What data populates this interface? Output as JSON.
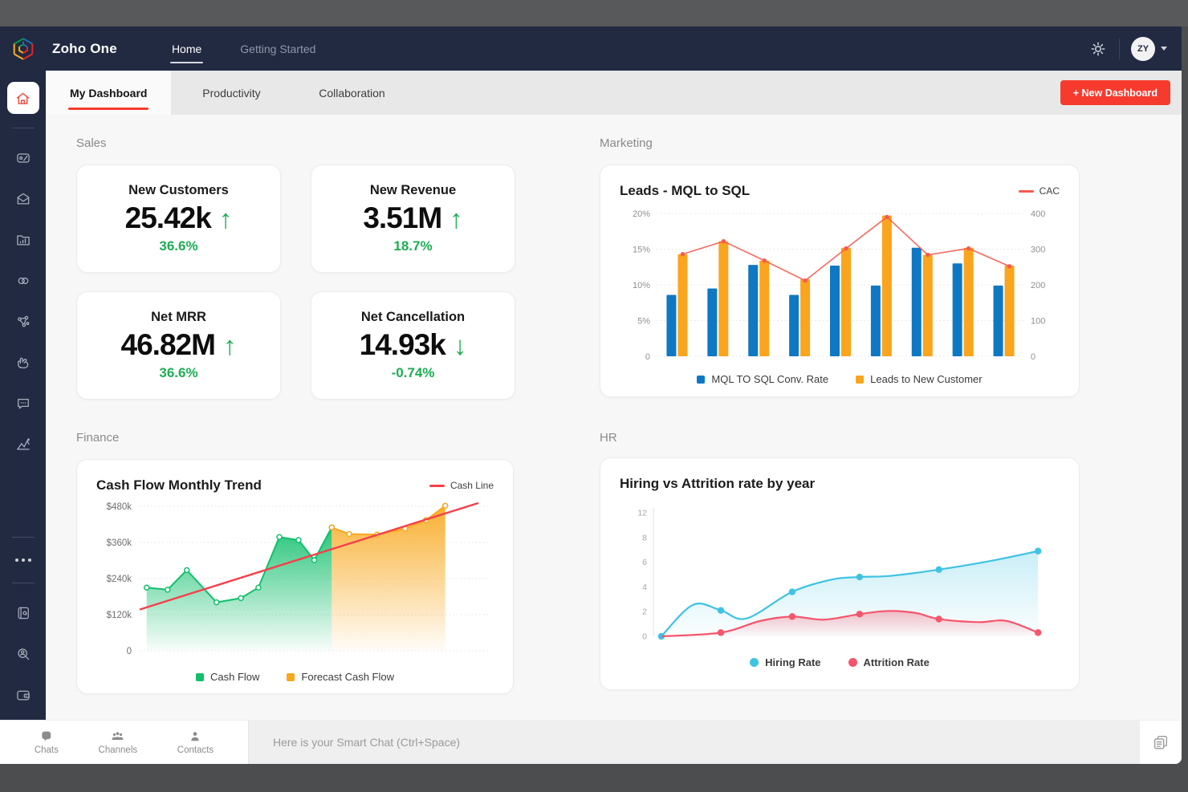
{
  "topnav": {
    "brand": "Zoho One",
    "links": [
      {
        "label": "Home",
        "active": true
      },
      {
        "label": "Getting Started",
        "active": false
      }
    ],
    "avatar_initials": "ZY"
  },
  "tabs": {
    "items": [
      {
        "label": "My Dashboard",
        "active": true
      },
      {
        "label": "Productivity",
        "active": false
      },
      {
        "label": "Collaboration",
        "active": false
      }
    ],
    "new_dashboard": "+ New Dashboard"
  },
  "sidebar": {
    "icons": [
      "home",
      "crm-card",
      "mail",
      "folder-analytics",
      "link-loops",
      "connections",
      "hand-gesture",
      "chat-bubble",
      "analytics-mountain",
      "more-ellipsis",
      "notebook",
      "people-search",
      "wallet"
    ]
  },
  "sections": {
    "sales": "Sales",
    "marketing": "Marketing",
    "finance": "Finance",
    "hr": "HR"
  },
  "kpis": [
    {
      "title": "New Customers",
      "value": "25.42k",
      "arrow": "↑",
      "delta": "36.6%"
    },
    {
      "title": "New Revenue",
      "value": "3.51M",
      "arrow": "↑",
      "delta": "18.7%"
    },
    {
      "title": "Net MRR",
      "value": "46.82M",
      "arrow": "↑",
      "delta": "36.6%"
    },
    {
      "title": "Net Cancellation",
      "value": "14.93k",
      "arrow": "↓",
      "delta": "-0.74%"
    }
  ],
  "chart_data": [
    {
      "id": "marketing",
      "type": "bar",
      "title": "Leads - MQL to SQL",
      "line_legend": "CAC",
      "left_axis": {
        "ticks": [
          "20%",
          "15%",
          "10%",
          "5%",
          "0"
        ],
        "max": 20
      },
      "right_axis": {
        "ticks": [
          "400",
          "300",
          "200",
          "100",
          "0"
        ],
        "max": 400
      },
      "grid": "dotted-horizontal",
      "legend_position": "bottom",
      "series": [
        {
          "name": "MQL TO SQL Conv. Rate",
          "type": "bar",
          "axis": "left",
          "color": "#0e78c4",
          "values": [
            8.6,
            9.5,
            12.8,
            8.6,
            12.7,
            9.9,
            15.2,
            13.0,
            9.9
          ]
        },
        {
          "name": "Leads to New Customer",
          "type": "bar",
          "axis": "left",
          "color": "#faa51d",
          "values": [
            14.3,
            16.1,
            13.4,
            10.8,
            15.2,
            19.7,
            14.2,
            15.2,
            12.7
          ]
        },
        {
          "name": "CAC",
          "type": "line",
          "axis": "right",
          "color": "#f65a4e",
          "values": [
            286,
            322,
            268,
            212,
            302,
            390,
            284,
            302,
            252
          ]
        }
      ]
    },
    {
      "id": "finance",
      "type": "area",
      "title": "Cash Flow Monthly Trend",
      "line_legend": "Cash Line",
      "y_axis": {
        "ticks": [
          "$480k",
          "$360k",
          "$240k",
          "$120k",
          "0"
        ],
        "max": 480
      },
      "grid": "dotted-horizontal",
      "legend_position": "bottom",
      "series": [
        {
          "name": "Cash Flow",
          "type": "area",
          "color": "#11bf6c",
          "x": [
            0.02,
            0.08,
            0.135,
            0.22,
            0.29,
            0.34,
            0.4,
            0.455,
            0.5,
            0.55
          ],
          "values": [
            210,
            203,
            268,
            161,
            175,
            210,
            378,
            368,
            301,
            410
          ]
        },
        {
          "name": "Forecast Cash Flow",
          "type": "area",
          "color": "#f8a71b",
          "x": [
            0.55,
            0.6,
            0.68,
            0.76,
            0.82,
            0.875
          ],
          "values": [
            410,
            388,
            386,
            406,
            434,
            482
          ]
        },
        {
          "name": "Cash Line",
          "type": "line",
          "color": "#f6404b",
          "x": [
            0.0,
            0.97
          ],
          "values": [
            137,
            491
          ]
        }
      ]
    },
    {
      "id": "hr",
      "type": "line",
      "title": "Hiring vs Attrition rate by year",
      "y_axis": {
        "ticks": [
          "12",
          "8",
          "6",
          "4",
          "2",
          "0"
        ]
      },
      "legend_position": "bottom",
      "series": [
        {
          "name": "Hiring Rate",
          "color": "#3fc3e3",
          "markers_x": [
            0.02,
            0.17,
            0.35,
            0.52,
            0.72,
            0.97
          ],
          "values": [
            0,
            2.1,
            3.6,
            4.8,
            5.4,
            6.9
          ],
          "curve": [
            [
              0.02,
              0
            ],
            [
              0.1,
              2.55
            ],
            [
              0.17,
              2.1
            ],
            [
              0.235,
              1.45
            ],
            [
              0.35,
              3.6
            ],
            [
              0.45,
              4.6
            ],
            [
              0.52,
              4.8
            ],
            [
              0.6,
              4.9
            ],
            [
              0.72,
              5.4
            ],
            [
              0.85,
              6.1
            ],
            [
              0.97,
              6.9
            ]
          ]
        },
        {
          "name": "Attrition Rate",
          "color": "#f5566b",
          "markers_x": [
            0.17,
            0.35,
            0.52,
            0.72,
            0.97
          ],
          "values": [
            0.3,
            1.6,
            1.8,
            1.4,
            0.3
          ],
          "curve": [
            [
              0.02,
              0
            ],
            [
              0.17,
              0.3
            ],
            [
              0.27,
              1.25
            ],
            [
              0.35,
              1.6
            ],
            [
              0.43,
              1.35
            ],
            [
              0.52,
              1.8
            ],
            [
              0.59,
              2.05
            ],
            [
              0.66,
              1.9
            ],
            [
              0.72,
              1.4
            ],
            [
              0.82,
              1.15
            ],
            [
              0.89,
              1.25
            ],
            [
              0.97,
              0.3
            ]
          ]
        }
      ]
    }
  ],
  "chatbar": {
    "tabs": [
      {
        "label": "Chats"
      },
      {
        "label": "Channels"
      },
      {
        "label": "Contacts"
      }
    ],
    "placeholder": "Here is your Smart Chat (Ctrl+Space)"
  },
  "colors": {
    "accent_red": "#f63b2e",
    "positive_green": "#1cae53",
    "navy": "#222a42"
  }
}
